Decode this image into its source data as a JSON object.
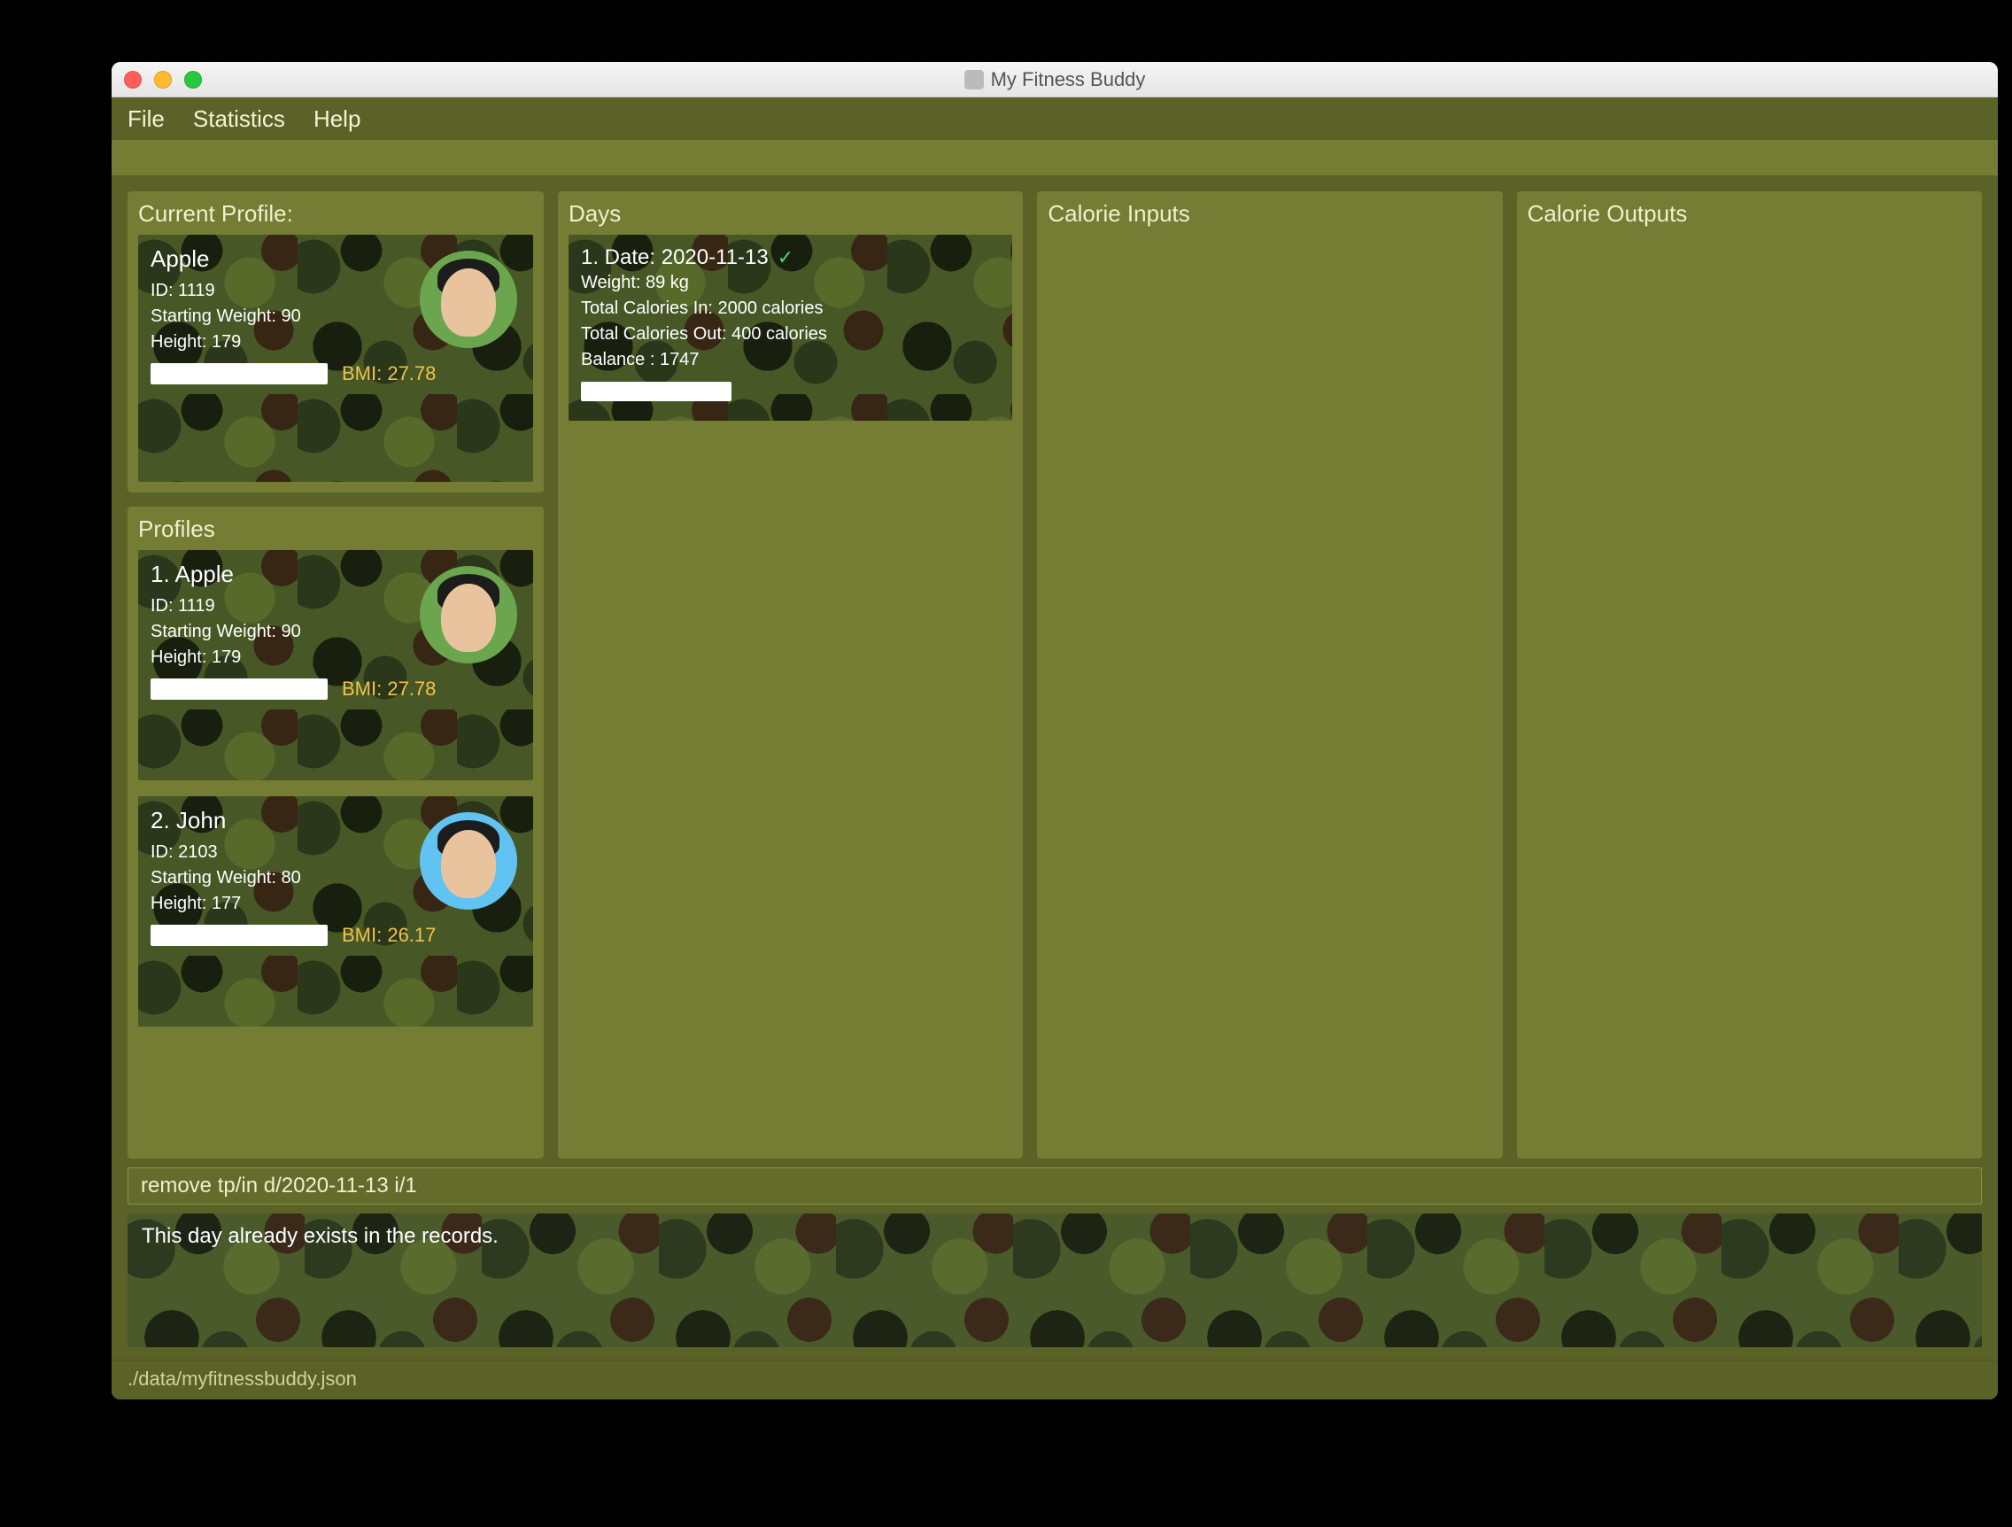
{
  "window": {
    "title": "My Fitness Buddy"
  },
  "menu": {
    "file": "File",
    "statistics": "Statistics",
    "help": "Help"
  },
  "panels": {
    "current_profile_title": "Current Profile:",
    "profiles_title": "Profiles",
    "days_title": "Days",
    "calorie_in_title": "Calorie Inputs",
    "calorie_out_title": "Calorie Outputs"
  },
  "current_profile": {
    "name": "Apple",
    "id_label": "ID: 1119",
    "start_weight_label": "Starting Weight: 90",
    "height_label": "Height: 179",
    "bmi_label": "BMI: 27.78"
  },
  "profiles": [
    {
      "index_name": "1.   Apple",
      "id_label": "ID: 1119",
      "start_weight_label": "Starting Weight: 90",
      "height_label": "Height: 179",
      "bmi_label": "BMI: 27.78",
      "avatar_bg": "green"
    },
    {
      "index_name": "2.   John",
      "id_label": "ID: 2103",
      "start_weight_label": "Starting Weight: 80",
      "height_label": "Height: 177",
      "bmi_label": "BMI: 26.17",
      "avatar_bg": "blue"
    }
  ],
  "days": [
    {
      "title": "1.   Date: 2020-11-13",
      "weight": "Weight: 89 kg",
      "cal_in": "Total Calories In: 2000 calories",
      "cal_out": "Total Calories Out: 400 calories",
      "balance": "Balance : 1747"
    }
  ],
  "command": {
    "value": "remove tp/in d/2020-11-13 i/1"
  },
  "message": {
    "text": "This day already exists in the records."
  },
  "status": {
    "path": "./data/myfitnessbuddy.json"
  }
}
